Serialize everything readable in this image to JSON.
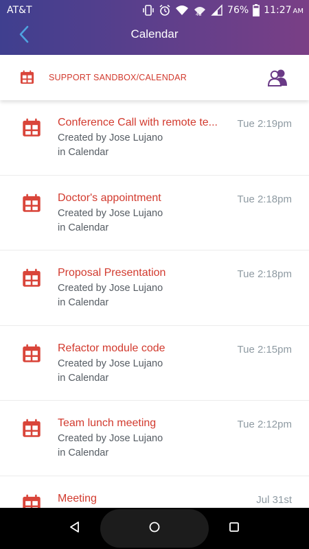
{
  "status_bar": {
    "carrier": "AT&T",
    "battery_percent": "76%",
    "time": "11:27",
    "ampm": "AM",
    "icons": [
      "vibrate-icon",
      "alarm-icon",
      "wifi-icon",
      "data-icon",
      "signal-icon",
      "battery-icon"
    ]
  },
  "appbar": {
    "title": "Calendar",
    "back_icon": "chevron-left-icon"
  },
  "subheader": {
    "label": "SUPPORT SANDBOX/CALENDAR",
    "icon": "calendar-icon",
    "action_icon": "members-icon"
  },
  "colors": {
    "accent_red": "#d23a2e",
    "header_start": "#3f3f8f",
    "header_end": "#7a3f86",
    "members_purple": "#6a3a86",
    "time_gray": "#8e9aa2",
    "back_blue": "#4fa3e0"
  },
  "events": [
    {
      "title": "Conference Call with remote te...",
      "time": "Tue 2:19pm",
      "creator": "Created by Jose Lujano",
      "location": "in Calendar"
    },
    {
      "title": "Doctor's appointment",
      "time": "Tue 2:18pm",
      "creator": "Created by Jose Lujano",
      "location": "in Calendar"
    },
    {
      "title": "Proposal Presentation",
      "time": "Tue 2:18pm",
      "creator": "Created by Jose Lujano",
      "location": "in Calendar"
    },
    {
      "title": "Refactor module code",
      "time": "Tue 2:15pm",
      "creator": "Created by Jose Lujano",
      "location": "in Calendar"
    },
    {
      "title": "Team lunch meeting",
      "time": "Tue 2:12pm",
      "creator": "Created by Jose Lujano",
      "location": "in Calendar"
    },
    {
      "title": "Meeting",
      "time": "Jul 31st",
      "creator": "",
      "location": ""
    }
  ],
  "navbar": {
    "buttons": [
      "back-triangle-icon",
      "home-circle-icon",
      "recents-square-icon"
    ]
  }
}
